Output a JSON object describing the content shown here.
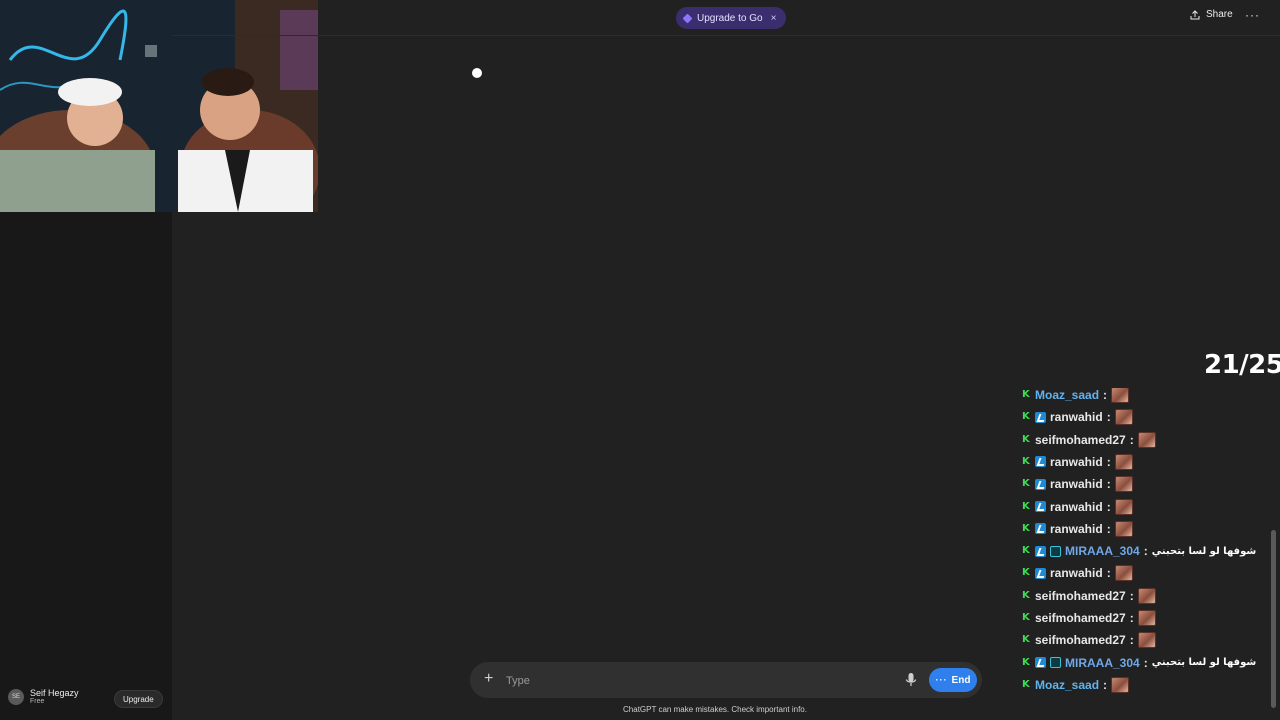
{
  "topbar": {
    "upgrade_pill": "Upgrade to Go",
    "upgrade_close": "×",
    "share_label": "Share",
    "more_label": "···"
  },
  "overlay": {
    "counter": "21/25"
  },
  "chat": {
    "messages": [
      {
        "user": "Moaz_saad",
        "sep": ":",
        "badges": [
          "k"
        ],
        "text": ""
      },
      {
        "user": "ranwahid",
        "sep": ":",
        "badges": [
          "k",
          "sub"
        ],
        "text": ""
      },
      {
        "user": "seifmohamed27",
        "sep": ":",
        "badges": [
          "k"
        ],
        "text": ""
      },
      {
        "user": "ranwahid",
        "sep": ":",
        "badges": [
          "k",
          "sub"
        ],
        "text": ""
      },
      {
        "user": "ranwahid",
        "sep": ":",
        "badges": [
          "k",
          "sub"
        ],
        "text": ""
      },
      {
        "user": "ranwahid",
        "sep": ":",
        "badges": [
          "k",
          "sub"
        ],
        "text": ""
      },
      {
        "user": "ranwahid",
        "sep": ":",
        "badges": [
          "k",
          "sub"
        ],
        "text": ""
      },
      {
        "user": "MIRAAA_304",
        "sep": ":",
        "badges": [
          "k",
          "sub",
          "mod"
        ],
        "text": "شوفها لو لسا بتحبني"
      },
      {
        "user": "ranwahid",
        "sep": ":",
        "badges": [
          "k",
          "sub"
        ],
        "text": ""
      },
      {
        "user": "seifmohamed27",
        "sep": ":",
        "badges": [
          "k"
        ],
        "text": ""
      },
      {
        "user": "seifmohamed27",
        "sep": ":",
        "badges": [
          "k"
        ],
        "text": ""
      },
      {
        "user": "seifmohamed27",
        "sep": ":",
        "badges": [
          "k"
        ],
        "text": ""
      },
      {
        "user": "MIRAAA_304",
        "sep": ":",
        "badges": [
          "k",
          "sub",
          "mod"
        ],
        "text": "شوفها لو لسا بتحبني"
      },
      {
        "user": "Moaz_saad",
        "sep": ":",
        "badges": [
          "k"
        ],
        "text": ""
      }
    ]
  },
  "composer": {
    "placeholder": "Type",
    "plus": "+",
    "end_label": "End"
  },
  "footer": {
    "disclaimer": "ChatGPT can make mistakes. Check important info."
  },
  "user": {
    "initials": "SE",
    "name": "Seif Hegazy",
    "plan": "Free",
    "upgrade_label": "Upgrade"
  },
  "colors": {
    "background": "#212121",
    "sidebar": "#181818",
    "end_button": "#2f80ed",
    "upgrade_pill": "#3b2e6e",
    "kick_green": "#3ddc55"
  },
  "icons": [
    "upload-icon",
    "more-icon",
    "plus-icon",
    "mic-icon",
    "waveform-icon",
    "close-icon",
    "diamond-icon"
  ]
}
